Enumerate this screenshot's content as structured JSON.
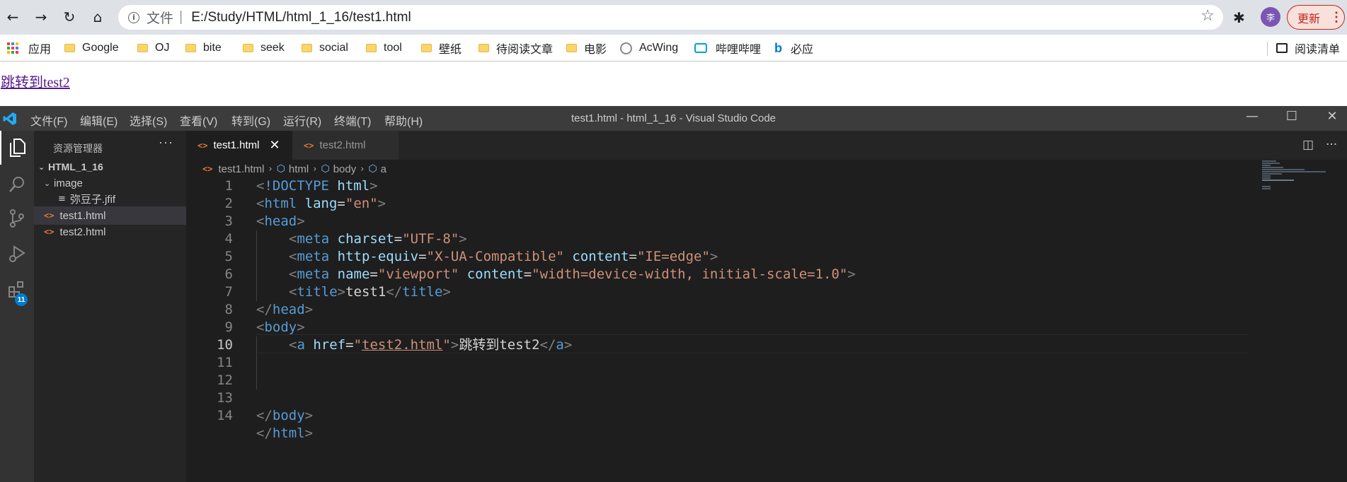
{
  "browser": {
    "address": {
      "scheme_label": "文件",
      "separator": "|",
      "url": "E:/Study/HTML/html_1_16/test1.html"
    },
    "avatar_initial": "李",
    "update_label": "更新",
    "update_menu": "⋮",
    "bookmarks": [
      {
        "label": "应用",
        "icon": "apps-grid-icon"
      },
      {
        "label": "Google",
        "icon": "folder-icon"
      },
      {
        "label": "OJ",
        "icon": "folder-icon"
      },
      {
        "label": "bite",
        "icon": "folder-icon"
      },
      {
        "label": "seek",
        "icon": "folder-icon"
      },
      {
        "label": "social",
        "icon": "folder-icon"
      },
      {
        "label": "tool",
        "icon": "folder-icon"
      },
      {
        "label": "壁纸",
        "icon": "folder-icon"
      },
      {
        "label": "待阅读文章",
        "icon": "folder-icon"
      },
      {
        "label": "电影",
        "icon": "folder-icon"
      },
      {
        "label": "AcWing",
        "icon": "acwing-icon"
      },
      {
        "label": "哔哩哔哩",
        "icon": "bilibili-icon"
      },
      {
        "label": "必应",
        "icon": "bing-icon"
      }
    ],
    "reading_list": "阅读清单",
    "page": {
      "link_text": "跳转到test2"
    }
  },
  "vscode": {
    "menu": [
      "文件(F)",
      "编辑(E)",
      "选择(S)",
      "查看(V)",
      "转到(G)",
      "运行(R)",
      "终端(T)",
      "帮助(H)"
    ],
    "window_title": "test1.html - html_1_16 - Visual Studio Code",
    "activity_badge": "11",
    "explorer": {
      "title": "资源管理器",
      "more": "···",
      "root": "HTML_1_16",
      "folder": "image",
      "folder_file": "弥豆子.jfif",
      "files": [
        "test1.html",
        "test2.html"
      ]
    },
    "tabs": [
      {
        "label": "test1.html",
        "active": true
      },
      {
        "label": "test2.html",
        "active": false
      }
    ],
    "breadcrumb": [
      "test1.html",
      "html",
      "body",
      "a"
    ],
    "current_line": 10,
    "line_numbers": [
      "1",
      "2",
      "3",
      "4",
      "5",
      "6",
      "7",
      "8",
      "9",
      "10",
      "11",
      "12",
      "13",
      "14"
    ],
    "code_tokens": {
      "l1": [
        "<",
        "!DOCTYPE",
        " html",
        ">"
      ],
      "l2": [
        "<",
        "html",
        " lang",
        "=",
        "\"en\"",
        ">"
      ],
      "l3": [
        "<",
        "head",
        ">"
      ],
      "l4": [
        "<",
        "meta",
        " charset",
        "=",
        "\"UTF-8\"",
        ">"
      ],
      "l5": [
        "<",
        "meta",
        " http-equiv",
        "=",
        "\"X-UA-Compatible\"",
        " content",
        "=",
        "\"IE=edge\"",
        ">"
      ],
      "l6": [
        "<",
        "meta",
        " name",
        "=",
        "\"viewport\"",
        " content",
        "=",
        "\"width=device-width, initial-scale=1.0\"",
        ">"
      ],
      "l7": [
        "<",
        "title",
        ">",
        "test1",
        "</",
        "title",
        ">"
      ],
      "l8": [
        "</",
        "head",
        ">"
      ],
      "l9": [
        "<",
        "body",
        ">"
      ],
      "l10": [
        "<",
        "a",
        " href",
        "=",
        "\"",
        "test2.html",
        "\"",
        ">",
        "跳转到test2",
        "</",
        "a",
        ">"
      ],
      "l13": [
        "</",
        "body",
        ">"
      ],
      "l14": [
        "</",
        "html",
        ">"
      ]
    },
    "colors": {
      "tag": "#569cd6",
      "attr": "#9cdcfe",
      "string": "#ce9178",
      "punct": "#808080",
      "text": "#d4d4d4"
    }
  }
}
